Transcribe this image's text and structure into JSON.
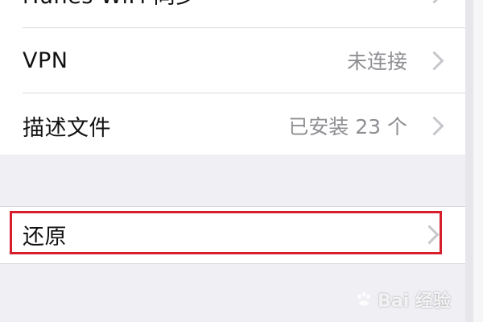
{
  "settings": {
    "partial_item": {
      "label": "iTunes WiFi 同步"
    },
    "items": [
      {
        "label": "VPN",
        "detail": "未连接"
      },
      {
        "label": "描述文件",
        "detail": "已安装 23 个"
      }
    ],
    "reset": {
      "label": "还原"
    }
  },
  "watermark": {
    "text": "Bai 经验"
  },
  "colors": {
    "highlight": "#d81e2c",
    "background": "#efeff4",
    "detail_text": "#8e8e93",
    "chevron": "#c7c7cc"
  },
  "icons": [
    "chevron-right-icon",
    "baidu-paw-icon"
  ]
}
